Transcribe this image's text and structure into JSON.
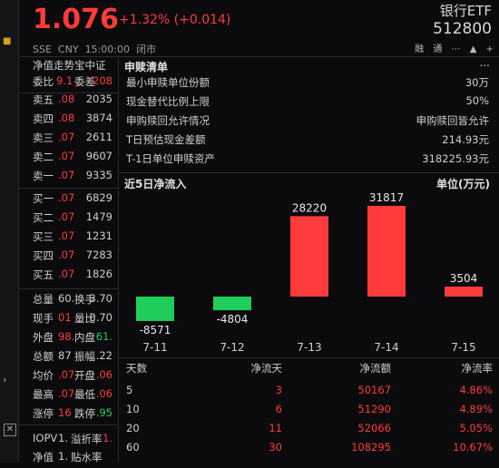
{
  "header": {
    "price": "1.076",
    "change": "+1.32% (+0.014)",
    "exchange": "SSE",
    "currency": "CNY",
    "time": "15:00:00",
    "status": "闭市",
    "name": "银行ETF",
    "code": "512800",
    "icons": [
      "融",
      "通",
      "⋯",
      "▲",
      "+"
    ]
  },
  "colors": {
    "up": "#ff3b3b",
    "down": "#1fce5a",
    "bg": "#0b0b0d"
  },
  "order_book": {
    "title": "净值走势宝中证",
    "ratio_label": "委比",
    "ratio_value": "9.1",
    "diff_label": "委差",
    "diff_value": "208",
    "asks": [
      {
        "label": "卖五",
        "price": ".08",
        "volume": "2035"
      },
      {
        "label": "卖四",
        "price": ".08",
        "volume": "3874"
      },
      {
        "label": "卖三",
        "price": ".07",
        "volume": "2611"
      },
      {
        "label": "卖二",
        "price": ".07",
        "volume": "9607"
      },
      {
        "label": "卖一",
        "price": ".07",
        "volume": "9335"
      }
    ],
    "bids": [
      {
        "label": "买一",
        "price": ".07",
        "volume": "6829"
      },
      {
        "label": "买二",
        "price": ".07",
        "volume": "1479"
      },
      {
        "label": "买三",
        "price": ".07",
        "volume": "1231"
      },
      {
        "label": "买四",
        "price": ".07",
        "volume": "7283"
      },
      {
        "label": "买五",
        "price": ".07",
        "volume": "1826"
      }
    ],
    "stats": [
      {
        "l": "总量",
        "lv": "60.",
        "r": "换手",
        "rv": "3.70"
      },
      {
        "l": "现手",
        "lv": "01",
        "r": "量比",
        "rv": "0.70"
      },
      {
        "l": "外盘",
        "lv": "98.",
        "r": "内盘",
        "rv": "61."
      },
      {
        "l": "总额",
        "lv": "87",
        "r": "振幅",
        "rv": ".22"
      },
      {
        "l": "均价",
        "lv": ".07",
        "r": "开盘",
        "rv": ".06"
      },
      {
        "l": "最高",
        "lv": ".07",
        "r": "最低",
        "rv": ".06"
      },
      {
        "l": "涨停",
        "lv": "16",
        "r": "跌停",
        "rv": ".95"
      }
    ],
    "iopv": [
      {
        "l": "IOPV",
        "lv": "1.",
        "r": "溢折率",
        "rv": "1."
      },
      {
        "l": "净值",
        "lv": "1.",
        "r": "贴水率",
        "rv": ""
      }
    ]
  },
  "redemption": {
    "title": "申赎清单",
    "more": "...",
    "rows": [
      {
        "key": "最小申赎单位份额",
        "value": "30万"
      },
      {
        "key": "现金替代比例上限",
        "value": "50%"
      },
      {
        "key": "申购赎回允许情况",
        "value": "申购赎回皆允许"
      },
      {
        "key": "T日预估现金差额",
        "value": "214.93元"
      },
      {
        "key": "T-1日单位申赎资产",
        "value": "318225.93元"
      }
    ]
  },
  "chart_data": {
    "type": "bar",
    "title": "近5日净流入",
    "unit": "单位(万元)",
    "categories": [
      "7-11",
      "7-12",
      "7-13",
      "7-14",
      "7-15"
    ],
    "values": [
      -8571,
      -4804,
      28220,
      31817,
      3504
    ]
  },
  "flow_table": {
    "headers": [
      "天数",
      "净流天",
      "净流额",
      "净流率"
    ],
    "rows": [
      [
        "5",
        "3",
        "50167",
        "4.86%"
      ],
      [
        "10",
        "6",
        "51290",
        "4.89%"
      ],
      [
        "20",
        "11",
        "52066",
        "5.05%"
      ],
      [
        "60",
        "30",
        "108295",
        "10.67%"
      ]
    ]
  }
}
